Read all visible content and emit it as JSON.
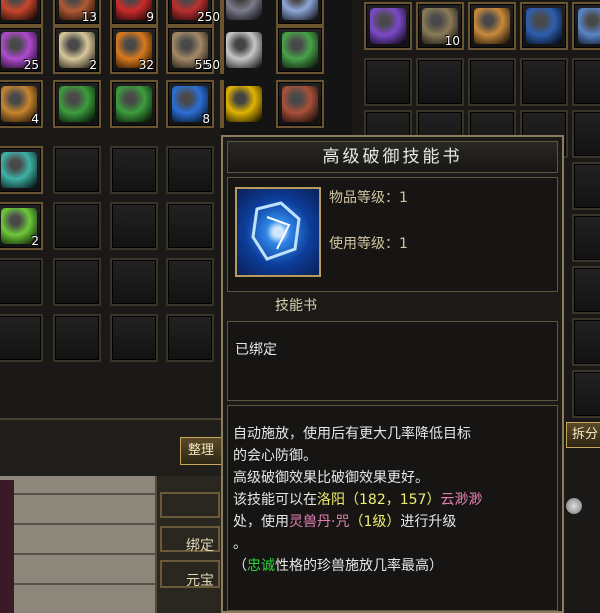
{
  "inventory_left": [
    {
      "row": 0,
      "col": 0,
      "icon": "red-gem-icon",
      "color": "#c8472c",
      "qty": ""
    },
    {
      "row": 0,
      "col": 1,
      "icon": "scroll-icon",
      "color": "#b05a33",
      "qty": "13"
    },
    {
      "row": 0,
      "col": 2,
      "icon": "red-orb-icon",
      "color": "#cc2b2b",
      "qty": "9"
    },
    {
      "row": 0,
      "col": 3,
      "icon": "target-icon",
      "color": "#bb3030",
      "qty": ""
    },
    {
      "row": 0,
      "col": 4,
      "icon": "crystal-stack-icon",
      "color": "#7b7b8c",
      "qty": "250"
    },
    {
      "row": 0,
      "col": 5,
      "icon": "blue-shard-icon",
      "color": "#8fa8d8",
      "qty": ""
    },
    {
      "row": 1,
      "col": 0,
      "icon": "purple-gem-icon",
      "color": "#b04ad0",
      "qty": "25"
    },
    {
      "row": 1,
      "col": 1,
      "icon": "paper-scroll-icon",
      "color": "#d8c79a",
      "qty": "2"
    },
    {
      "row": 1,
      "col": 2,
      "icon": "fire-orb-icon",
      "color": "#d77a1e",
      "qty": "32"
    },
    {
      "row": 1,
      "col": 3,
      "icon": "parchment-icon",
      "color": "#a48a66",
      "qty": "55"
    },
    {
      "row": 1,
      "col": 4,
      "icon": "silver-ore-icon",
      "color": "#c7c7c7",
      "qty": "50"
    },
    {
      "row": 1,
      "col": 5,
      "icon": "green-carpet-icon",
      "color": "#49a34a",
      "qty": ""
    },
    {
      "row": 2,
      "col": 0,
      "icon": "rune-scroll-icon",
      "color": "#c7852f",
      "qty": "4"
    },
    {
      "row": 2,
      "col": 1,
      "icon": "green-carpet-icon",
      "color": "#3c9d3d",
      "qty": ""
    },
    {
      "row": 2,
      "col": 2,
      "icon": "green-carpet-icon",
      "color": "#3c9d3d",
      "qty": ""
    },
    {
      "row": 2,
      "col": 3,
      "icon": "skill-book-icon",
      "color": "#2b6fd6",
      "qty": "8"
    },
    {
      "row": 2,
      "col": 4,
      "icon": "meditating-figure-icon",
      "color": "#e1b400",
      "qty": ""
    },
    {
      "row": 2,
      "col": 5,
      "icon": "seal-scroll-icon",
      "color": "#a8503a",
      "qty": ""
    },
    {
      "row": 3,
      "col": 0,
      "icon": "teal-crystal-icon",
      "color": "#3fb1a6",
      "qty": ""
    },
    {
      "row": 4,
      "col": 0,
      "icon": "green-gem-icon",
      "color": "#6cc93a",
      "qty": "2"
    }
  ],
  "inventory_right": [
    {
      "col": 0,
      "icon": "purple-carpet-icon",
      "color": "#7c4ac9",
      "qty": ""
    },
    {
      "col": 1,
      "icon": "coffin-icon",
      "color": "#8a7a58",
      "qty": "10"
    },
    {
      "col": 2,
      "icon": "doll-icon",
      "color": "#c98a3b",
      "qty": ""
    },
    {
      "col": 3,
      "icon": "blue-book-icon",
      "color": "#2e5fb0",
      "qty": ""
    },
    {
      "col": 4,
      "icon": "blue-scroll-icon",
      "color": "#5a85c8",
      "qty": ""
    }
  ],
  "buttons": {
    "sort": "整理",
    "split": "拆分"
  },
  "side_labels": {
    "bound": "绑定",
    "ingot": "元宝"
  },
  "tooltip": {
    "title": "高级破御技能书",
    "item_level_label": "物品等级：",
    "item_level_value": "1",
    "use_level_label": "使用等级：",
    "use_level_value": "1",
    "type": "技能书",
    "bound_status": "已绑定",
    "desc_line1": "自动施放，使用后有更大几率降低目标",
    "desc_line2": "的会心防御。",
    "desc_line3": "高级破御效果比破御效果更好。",
    "desc_line4_a": "该技能可以在",
    "desc_line4_city": "洛阳",
    "desc_line4_coords": "（182，157）",
    "desc_line4_npc": "云渺渺",
    "desc_line5_a": "处，使用",
    "desc_line5_item": "灵兽丹·咒",
    "desc_line5_level": "（1级）",
    "desc_line5_b": "进行升级",
    "desc_line6": "。",
    "desc_line7_a": "（",
    "desc_line7_trait": "忠诚",
    "desc_line7_b": "性格的珍兽施放几率最高）"
  }
}
